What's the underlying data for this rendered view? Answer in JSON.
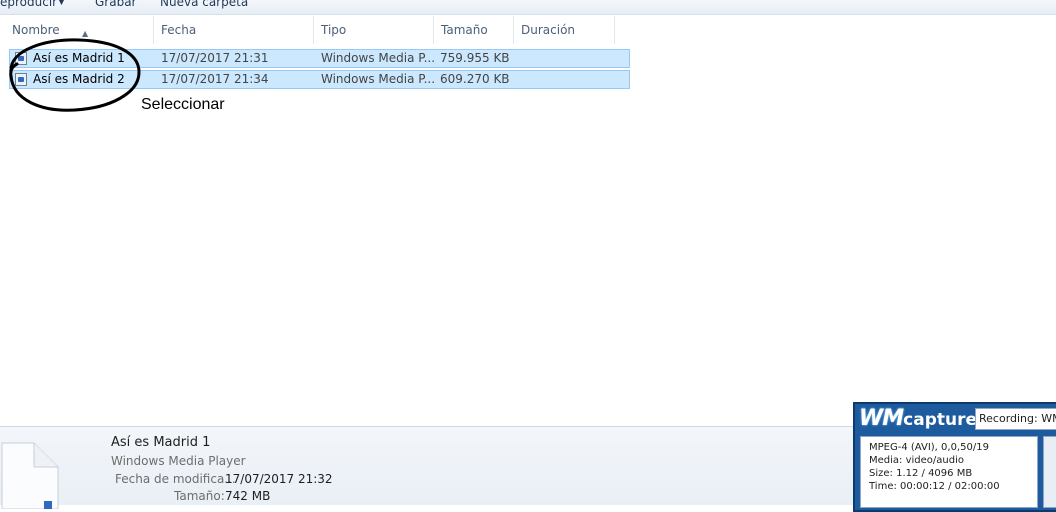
{
  "toolbar": {
    "reproducir_label": "eproducir",
    "grabar_label": "Grabar",
    "nueva_carpeta_label": "Nueva carpeta"
  },
  "columns": {
    "nombre": "Nombre",
    "fecha": "Fecha",
    "tipo": "Tipo",
    "tamano": "Tamaño",
    "duracion": "Duración"
  },
  "files": [
    {
      "name": "Así es Madrid 1",
      "date": "17/07/2017 21:31",
      "type": "Windows Media P...",
      "size": "759.955 KB"
    },
    {
      "name": "Así es Madrid 2",
      "date": "17/07/2017 21:34",
      "type": "Windows Media P...",
      "size": "609.270 KB"
    }
  ],
  "annotation": {
    "text": "Seleccionar"
  },
  "details": {
    "title": "Así es Madrid 1",
    "app": "Windows Media Player",
    "modified_label": "Fecha de modifica...",
    "modified_value": "17/07/2017 21:32",
    "size_label": "Tamaño:",
    "size_value": "742 MB"
  },
  "wmcapture": {
    "logo_wm": "WM",
    "logo_capture": "capture",
    "status": "Recording: WMC",
    "info": [
      "MPEG-4 (AVI), 0,0,50/19",
      "Media: video/audio",
      "Size: 1.12 / 4096 MB",
      "Time: 00:00:12 / 02:00:00"
    ]
  },
  "colors": {
    "selection_bg": "#cce8ff",
    "selection_border": "#99c9f2",
    "wm_blue": "#1e5b9e"
  }
}
